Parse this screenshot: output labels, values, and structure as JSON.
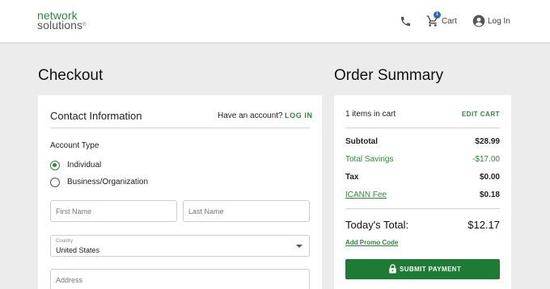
{
  "header": {
    "logo_line1": "network",
    "logo_line2": "solutions",
    "logo_reg": "®",
    "cart_count": "1",
    "cart_label": "Cart",
    "login_label": "Log In"
  },
  "checkout": {
    "heading": "Checkout",
    "contact_title": "Contact Information",
    "have_account": "Have an account?",
    "login_link": "LOG IN",
    "account_type_label": "Account Type",
    "account_types": [
      {
        "label": "Individual",
        "selected": true
      },
      {
        "label": "Business/Organization",
        "selected": false
      }
    ],
    "fields": {
      "first_name_placeholder": "First Name",
      "last_name_placeholder": "Last Name",
      "country_label": "Country",
      "country_value": "United States",
      "address_placeholder": "Address"
    }
  },
  "summary": {
    "heading": "Order Summary",
    "items_in_cart": "1 items in cart",
    "edit_cart": "EDIT CART",
    "rows": [
      {
        "label": "Subtotal",
        "value": "$28.99"
      },
      {
        "label": "Total Savings",
        "value": "-$17.00"
      },
      {
        "label": "Tax",
        "value": "$0.00"
      },
      {
        "label": "ICANN Fee",
        "value": "$0.18"
      }
    ],
    "total_label": "Today's Total:",
    "total_value": "$12.17",
    "promo": "Add Promo Code",
    "submit": "SUBMIT PAYMENT"
  },
  "colors": {
    "brand_green": "#2f8a3a",
    "button_green": "#1e7b34",
    "badge_blue": "#2b6cb0",
    "page_bg": "#ececec"
  },
  "icons": [
    "phone-icon",
    "cart-icon",
    "user-icon",
    "lock-icon",
    "chevron-down-icon"
  ]
}
